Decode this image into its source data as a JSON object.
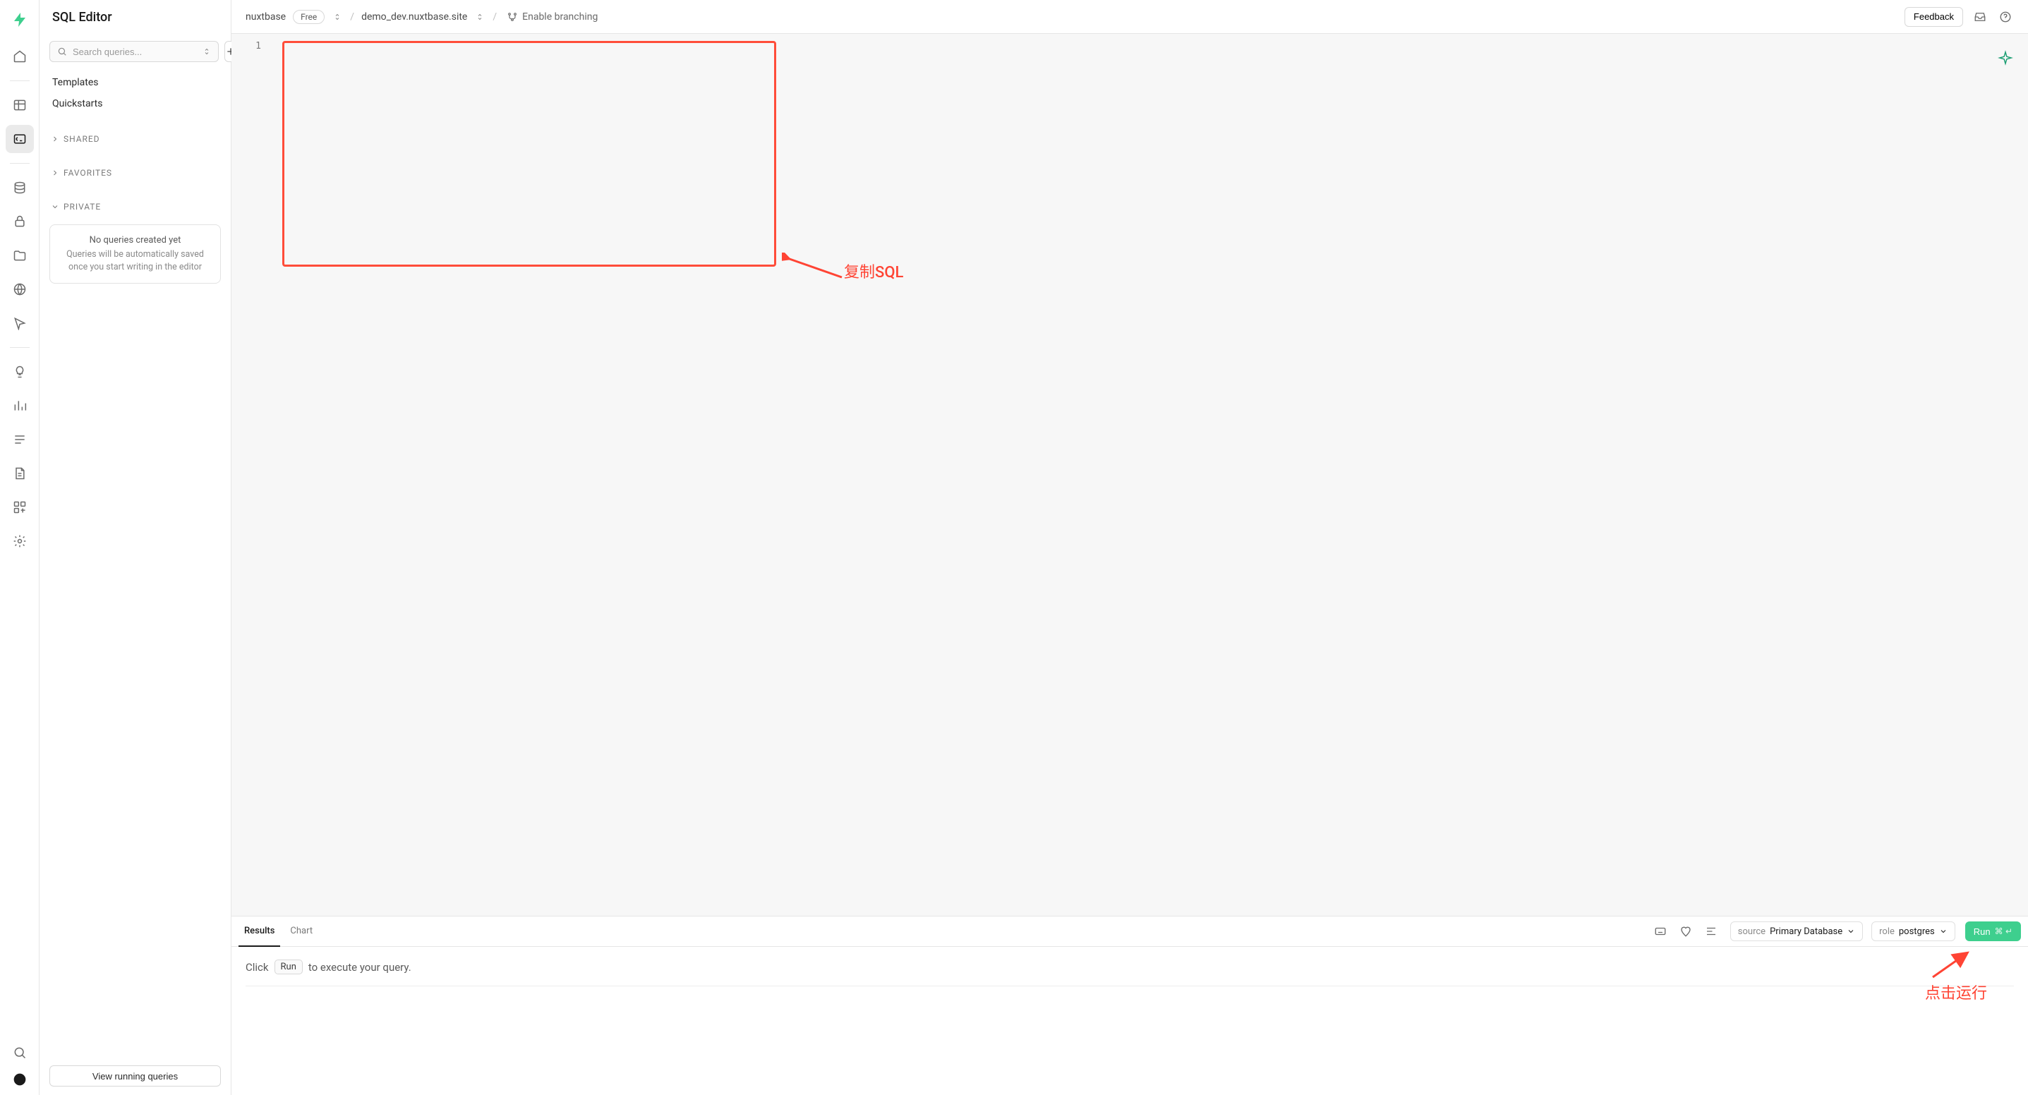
{
  "page_title": "SQL Editor",
  "search_placeholder": "Search queries...",
  "quicklinks": {
    "templates": "Templates",
    "quickstarts": "Quickstarts"
  },
  "sections": {
    "shared": "SHARED",
    "favorites": "FAVORITES",
    "private": "PRIVATE"
  },
  "empty_state": {
    "title": "No queries created yet",
    "subtitle": "Queries will be automatically saved once you start writing in the editor"
  },
  "footer_button": "View running queries",
  "breadcrumb": {
    "project": "nuxtbase",
    "plan": "Free",
    "site": "demo_dev.nuxtbase.site",
    "branching": "Enable branching"
  },
  "topbar_buttons": {
    "feedback": "Feedback"
  },
  "editor": {
    "line_numbers": [
      "1"
    ]
  },
  "annotations": {
    "copy_sql": "复制SQL",
    "click_run": "点击运行"
  },
  "results_toolbar": {
    "tabs": {
      "results": "Results",
      "chart": "Chart"
    },
    "source_label": "source",
    "source_value": "Primary Database",
    "role_label": "role",
    "role_value": "postgres",
    "run_label": "Run",
    "run_shortcut": "⌘ ↵"
  },
  "results_hint": {
    "before": "Click",
    "run_kbd": "Run",
    "after": "to execute your query."
  }
}
